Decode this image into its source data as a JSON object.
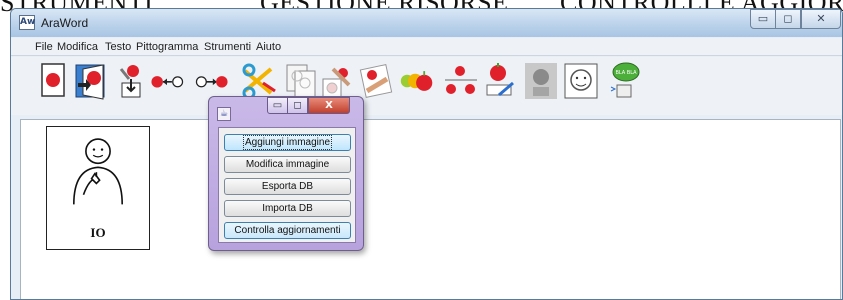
{
  "caption": {
    "col1": "STRUMENTI",
    "col2": "GESTIONE RISORSE",
    "col3": "CONTROLLI E AGGIORNAMENTI"
  },
  "window": {
    "title": "AraWord",
    "app_icon_text": "Aw",
    "min_glyph": "▭",
    "max_glyph": "◻",
    "close_glyph": "✕"
  },
  "menu": {
    "items": [
      "File",
      "Modifica",
      "Testo",
      "Pittogramma",
      "Strumenti",
      "Aiuto"
    ]
  },
  "toolbar": {
    "icons": [
      "new-document-icon",
      "open-document-icon",
      "save-document-icon",
      "previous-pictogram-icon",
      "next-pictogram-icon",
      "cut-icon",
      "copy-icon",
      "paste-icon",
      "change-pictogram-icon",
      "pictogram-size-icon",
      "pictogram-position-icon",
      "edit-pictogram-icon",
      "disabled-pictogram-icon",
      "face-icon",
      "speak-icon"
    ]
  },
  "card": {
    "label": "IO"
  },
  "dialog": {
    "icon_text": "☕",
    "min_glyph": "▭",
    "max_glyph": "◻",
    "close_glyph": "X",
    "buttons": [
      "Aggiungi immagine",
      "Modifica immagine",
      "Esporta DB",
      "Importa DB",
      "Controlla aggiornamenti"
    ]
  },
  "colors": {
    "accent_red": "#e0202a",
    "titlebar": "#b9d1ea",
    "dialog_frame": "#b8a2de"
  }
}
